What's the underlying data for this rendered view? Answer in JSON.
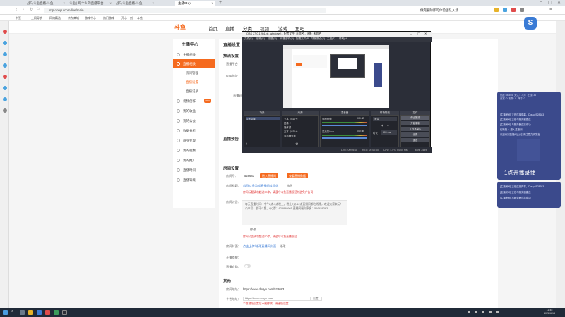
{
  "browser": {
    "tabs": [
      {
        "label": "战马斗鱼直播-斗鱼"
      },
      {
        "label": "斗鱼 | 每个人的直播平台"
      },
      {
        "label": "战马斗鱼直播-斗鱼"
      },
      {
        "label": "主播中心"
      }
    ],
    "address": "mp.douyu.com/live/main",
    "right_text": "做完删除即可体验团队入场",
    "bookmarks": [
      "书签",
      "上网导航",
      "网络精选",
      "京东商城",
      "游戏中心",
      "热门游戏",
      "开心一刻",
      "斗鱼",
      "微博",
      "视频"
    ]
  },
  "site": {
    "logo": "斗鱼",
    "nav": [
      "首页",
      "直播",
      "分类",
      "视频",
      "游戏",
      "鱼吧"
    ],
    "side_title": "主播中心",
    "side_items": [
      {
        "label": "主播相关"
      },
      {
        "label": "直播相关"
      },
      {
        "label": "视频创作"
      },
      {
        "label": "我的收益"
      },
      {
        "label": "我的公会"
      },
      {
        "label": "数据分析"
      },
      {
        "label": "商业变现"
      },
      {
        "label": "我的视频"
      },
      {
        "label": "我的推广"
      },
      {
        "label": "直播时间"
      },
      {
        "label": "直播等级"
      }
    ],
    "side_sub": [
      "房间管理",
      "直播设置",
      "直播记录"
    ],
    "new_tag": "NEW"
  },
  "main": {
    "title": "直播设置",
    "s1": "推流设置",
    "r1": "直播平台",
    "r2": "rtmp地址",
    "r3": "直播码",
    "s2": "直播预告",
    "s3": "房间设置",
    "room_no_label": "房间号：",
    "room_no": "528683",
    "btn_a": "进入直播间",
    "btn_b": "查看直播数据",
    "room_title_label": "房间标题：",
    "room_title": "战马斗鱼游戏直播间欢迎你",
    "edit": "修改",
    "warn1": "房间标题请勿超过30字，请遵守斗鱼直播规范并避免广告词",
    "notice_label": "房间公告：",
    "notice": "每天直播时间：中午2点-5点晚上，晚上7点-12点直播间都在线哦，欢迎大家来玩！ 公众号：战马斗鱼，QQ群：628899965 直播间福利多多：516438363",
    "edit2": "修改",
    "warn2": "房间公告请勿超过50字，请遵守斗鱼直播规范",
    "cover_label": "房间封面：",
    "cover_link": "点击上传/修改直播间封面",
    "edit3": "修改",
    "follow_label": "开播提醒：",
    "auto_label": "直播自动：",
    "s4": "其他",
    "room_addr_label": "房间地址：",
    "room_addr": "https://www.douyu.com/528683",
    "personal_label": "个性地址：",
    "personal_val": "https://www.douyu.com/",
    "personal_btn": "设置",
    "warn3": "个性地址设置后不能修改，请谨慎设置"
  },
  "obs": {
    "title": "OBS 27.0.1 (64-bit, windows) - 配置文件: 未命名 - 场景: 未命名",
    "menus": [
      "文件(F)",
      "编辑(E)",
      "视图(V)",
      "停靠部件(D)",
      "配置文件(P)",
      "场景集合(S)",
      "工具(T)",
      "帮助(H)"
    ],
    "panels": [
      "场景",
      "来源",
      "混音器",
      "转场特效",
      "控件"
    ],
    "scene": "斗鱼直播",
    "sources": [
      "文本（GDI+）",
      "图像 2",
      "媒体源",
      "文本（GDI+）",
      "显示器采集"
    ],
    "mixer": [
      "桌面音频",
      "麦克风/Aux"
    ],
    "mixer_db": [
      "0.0 dB",
      "0.0 dB"
    ],
    "trans": "渐变",
    "trans_dur": "时长",
    "trans_ms": "300 ms",
    "controls": [
      "停止推流",
      "开始录制",
      "工作室模式",
      "设置",
      "退出"
    ],
    "status": [
      "LIVE: 00:05:08",
      "REC: 00:00:00",
      "CPU: 4.5%, 60.00 fps",
      "kb/s: 2489"
    ]
  },
  "chat": {
    "stats": [
      "热度: 98465",
      "关注: 1.6万",
      "在线: 36",
      "贵宾: 0",
      "礼物: 0",
      "弹幕: 0"
    ],
    "lines": [
      "[主播房间] 正在连接弹幕，Douyu/528683",
      "[主播房间] 正在与服务器建连",
      "[主播房间] 与服务器连接成功",
      "佐助路人 进入直播间",
      "欢迎来到直播间(公告)请注意文明发言"
    ],
    "big": "1点开播录播",
    "lines2": [
      "[主播房间] 正在连接弹幕，Douyu/528683",
      "[主播房间] 正在与服务器建连",
      "[主播房间] 与服务器连接成功"
    ]
  },
  "float_btn": "S",
  "taskbar": {
    "time": "11:45",
    "date": "2022/6/14"
  }
}
